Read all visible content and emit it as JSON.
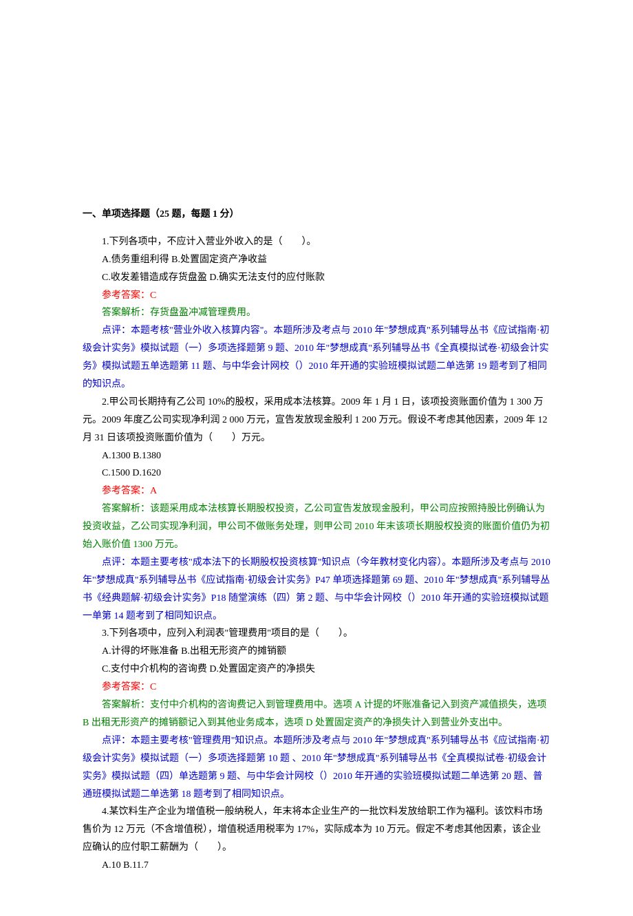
{
  "section_title": "一、单项选择题（25 题，每题 1 分）",
  "q1": {
    "stem": "1.下列各项中，不应计入营业外收入的是（　　）。",
    "optA": "A.债务重组利得 B.处置固定资产净收益",
    "optC": "C.收发差错造成存货盘盈 D.确实无法支付的应付账款",
    "answer": "参考答案：C",
    "explain": "答案解析：存货盘盈冲减管理费用。",
    "comment": "点评：本题考核\"营业外收入核算内容\"。本题所涉及考点与 2010 年\"梦想成真\"系列辅导丛书《应试指南·初级会计实务》模拟试题（一）多项选择题第 9 题、2010 年\"梦想成真\"系列辅导丛书《全真模拟试卷·初级会计实务》模拟试题五单选题第 11 题、与中华会计网校（）2010 年开通的实验班模拟试题二单选第 19 题考到了相同的知识点。"
  },
  "q2": {
    "stem": "2.甲公司长期持有乙公司 10%的股权，采用成本法核算。2009 年 1 月 1 日，该项投资账面价值为 1 300 万元。2009 年度乙公司实现净利润 2 000 万元，宣告发放现金股利 1 200 万元。假设不考虑其他因素，2009 年 12 月 31 日该项投资账面价值为（　　）万元。",
    "optA": "A.1300 B.1380",
    "optC": "C.1500 D.1620",
    "answer": "参考答案：A",
    "explain": "答案解析：该题采用成本法核算长期股权投资，乙公司宣告发放现金股利，甲公司应按照持股比例确认为投资收益，乙公司实现净利润，甲公司不做账务处理，则甲公司 2010 年末该项长期股权投资的账面价值仍为初始入账价值 1300 万元。",
    "comment": "点评：本题主要考核\"成本法下的长期股权投资核算\"知识点（今年教材变化内容）。本题所涉及考点与 2010 年\"梦想成真\"系列辅导丛书《应试指南·初级会计实务》P47 单项选择题第 69 题、2010 年\"梦想成真\"系列辅导丛书《经典题解·初级会计实务》P18 随堂演练（四）第 2 题、与中华会计网校（）2010 年开通的实验班模拟试题一单第 14 题考到了相同知识点。"
  },
  "q3": {
    "stem": "3.下列各项中，应列入利润表\"管理费用\"项目的是（　　）。",
    "optA": "A.计得的坏账准备 B.出租无形资产的摊销额",
    "optC": "C.支付中介机构的咨询费 D.处置固定资产的净损失",
    "answer": "参考答案：C",
    "explain": "答案解析：支付中介机构的咨询费记入到管理费用中。选项 A 计提的坏账准备记入到资产减值损失，选项 B 出租无形资产的摊销额记入到其他业务成本，选项 D 处置固定资产的净损失计入到营业外支出中。",
    "comment": "点评：本题主要考核\"管理费用\"知识点。本题所涉及考点与 2010 年\"梦想成真\"系列辅导丛书《应试指南·初级会计实务》模拟试题（一）多项选择题第 10 题 、2010 年\"梦想成真\"系列辅导丛书《全真模拟试卷·初级会计实务》模拟试题（四）单选题第 9 题、与中华会计网校（）2010 年开通的实验班模拟试题二单选第 20 题、普通班模拟试题二单选第 18 题考到了相同知识点。"
  },
  "q4": {
    "stem": "4.某饮料生产企业为增值税一般纳税人，年末将本企业生产的一批饮料发放给职工作为福利。该饮料市场售价为 12 万元（不含增值税），增值税适用税率为 17%，实际成本为 10 万元。假定不考虑其他因素，该企业应确认的应付职工薪酬为（　　）。",
    "optA": "A.10 B.11.7"
  }
}
